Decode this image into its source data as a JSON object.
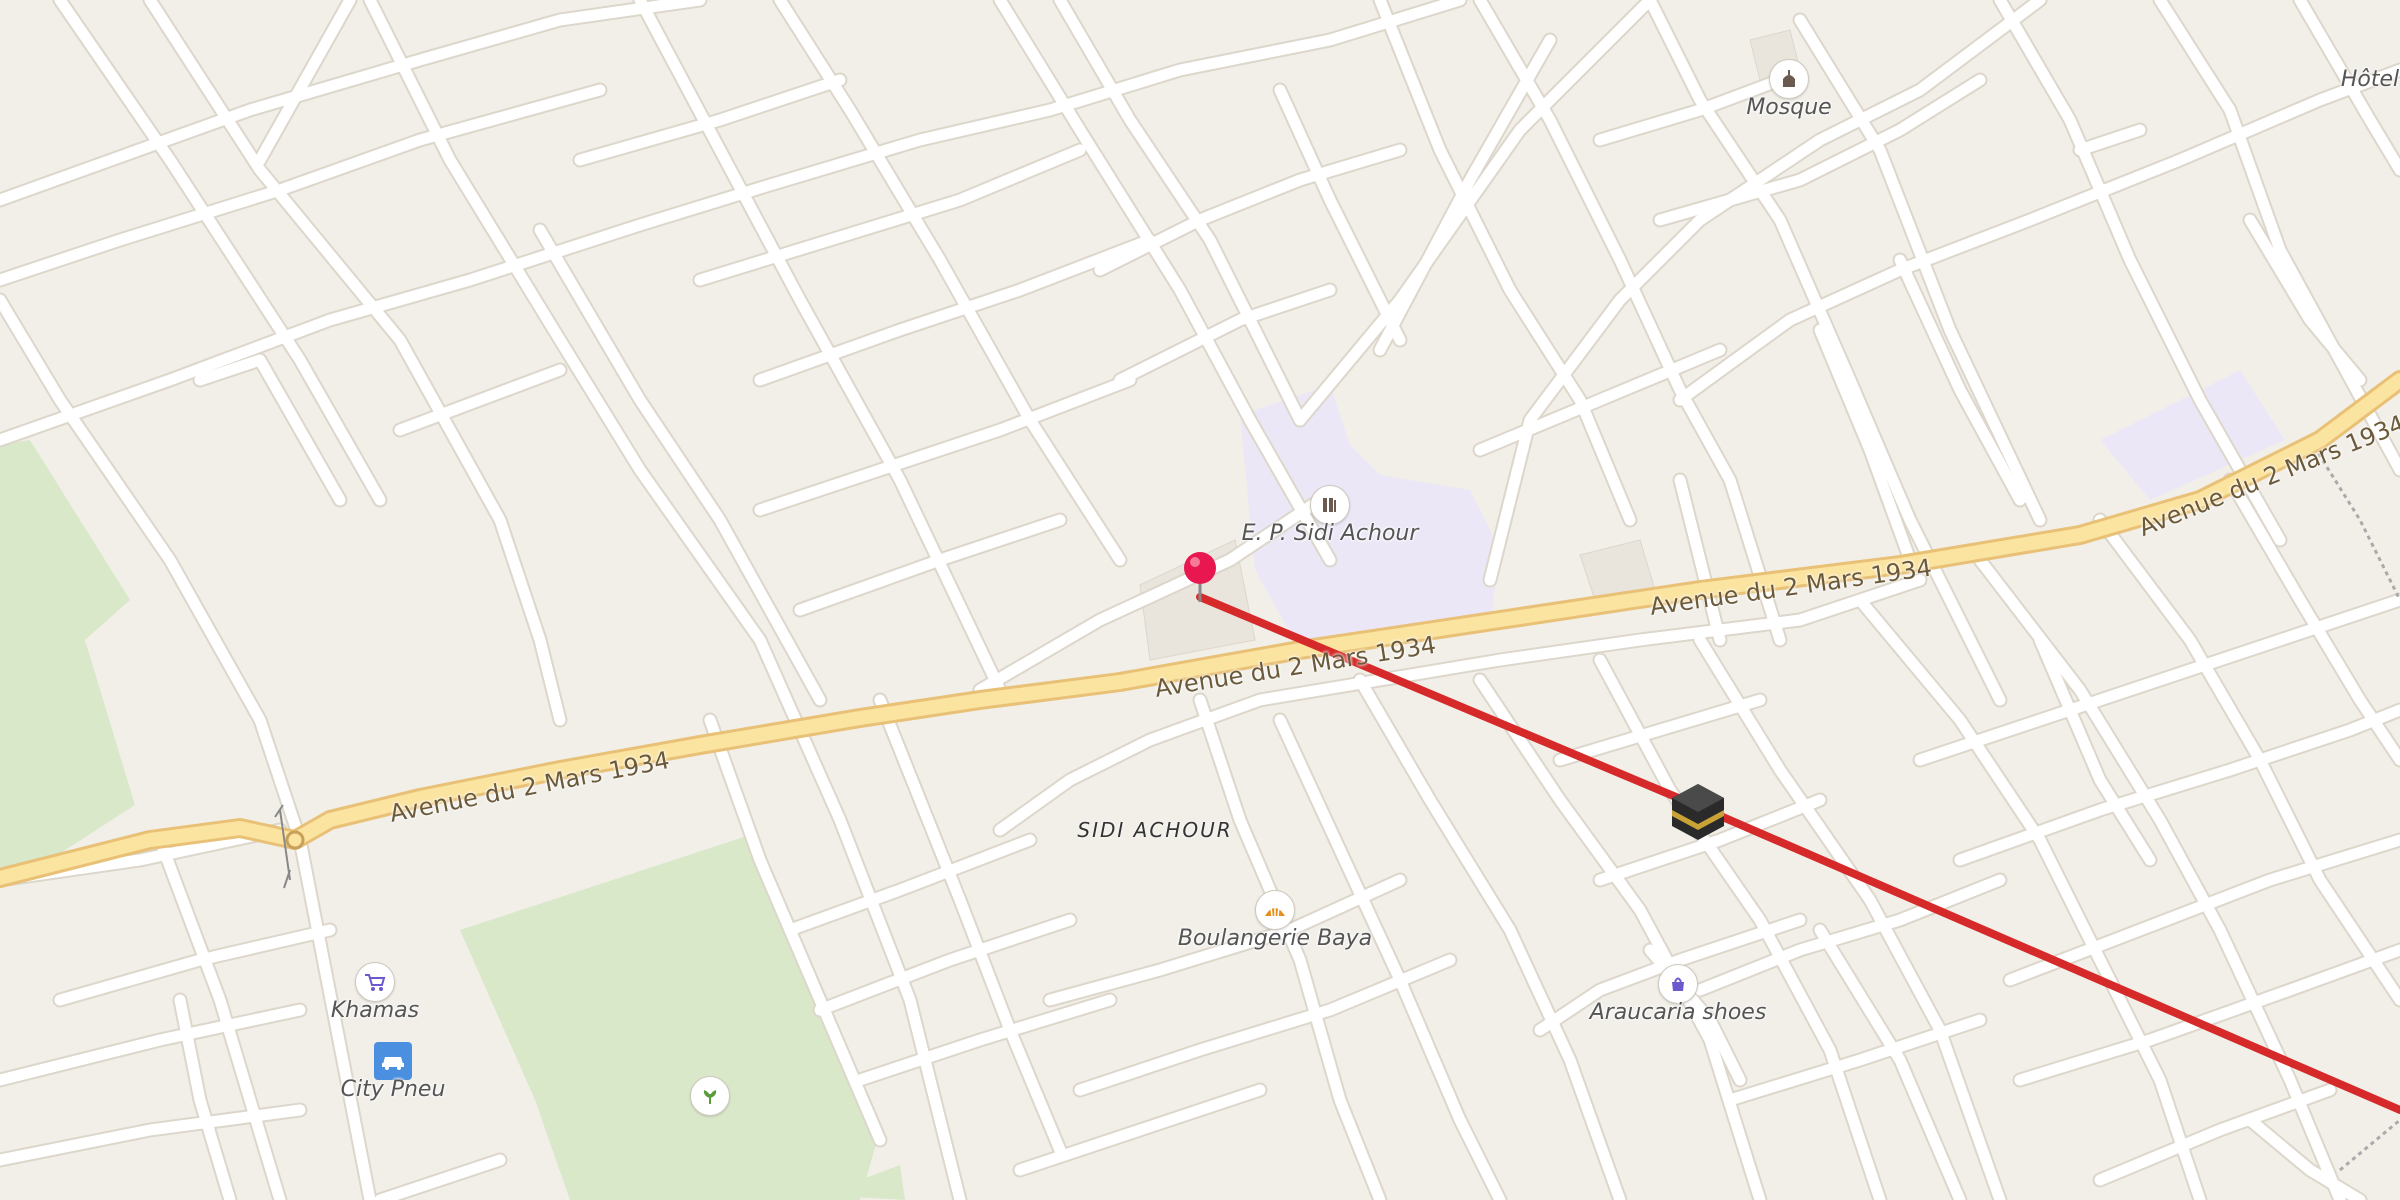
{
  "map": {
    "roads": {
      "main_name": "Avenue du 2 Mars 1934"
    },
    "district": "SIDI ACHOUR",
    "pois": [
      {
        "name": "Mosque",
        "icon": "mosque-icon"
      },
      {
        "name": "Hôtel",
        "icon": "hotel-icon"
      },
      {
        "name": "E. P. Sidi Achour",
        "icon": "school-icon"
      },
      {
        "name": "Boulangerie Baya",
        "icon": "bakery-icon"
      },
      {
        "name": "Araucaria shoes",
        "icon": "shoe-shop-icon"
      },
      {
        "name": "Khamas",
        "icon": "supermarket-icon"
      },
      {
        "name": "City Pneu",
        "icon": "car-repair-icon"
      },
      {
        "name": "",
        "icon": "garden-center-icon"
      }
    ],
    "colors": {
      "background": "#f2efe9",
      "minor_road": "#ffffff",
      "main_road": "#fbe3a0",
      "park": "#d9e8c9",
      "school_area": "#ece7f7",
      "route": "#d62a2a",
      "pin": "#e8174f"
    }
  }
}
